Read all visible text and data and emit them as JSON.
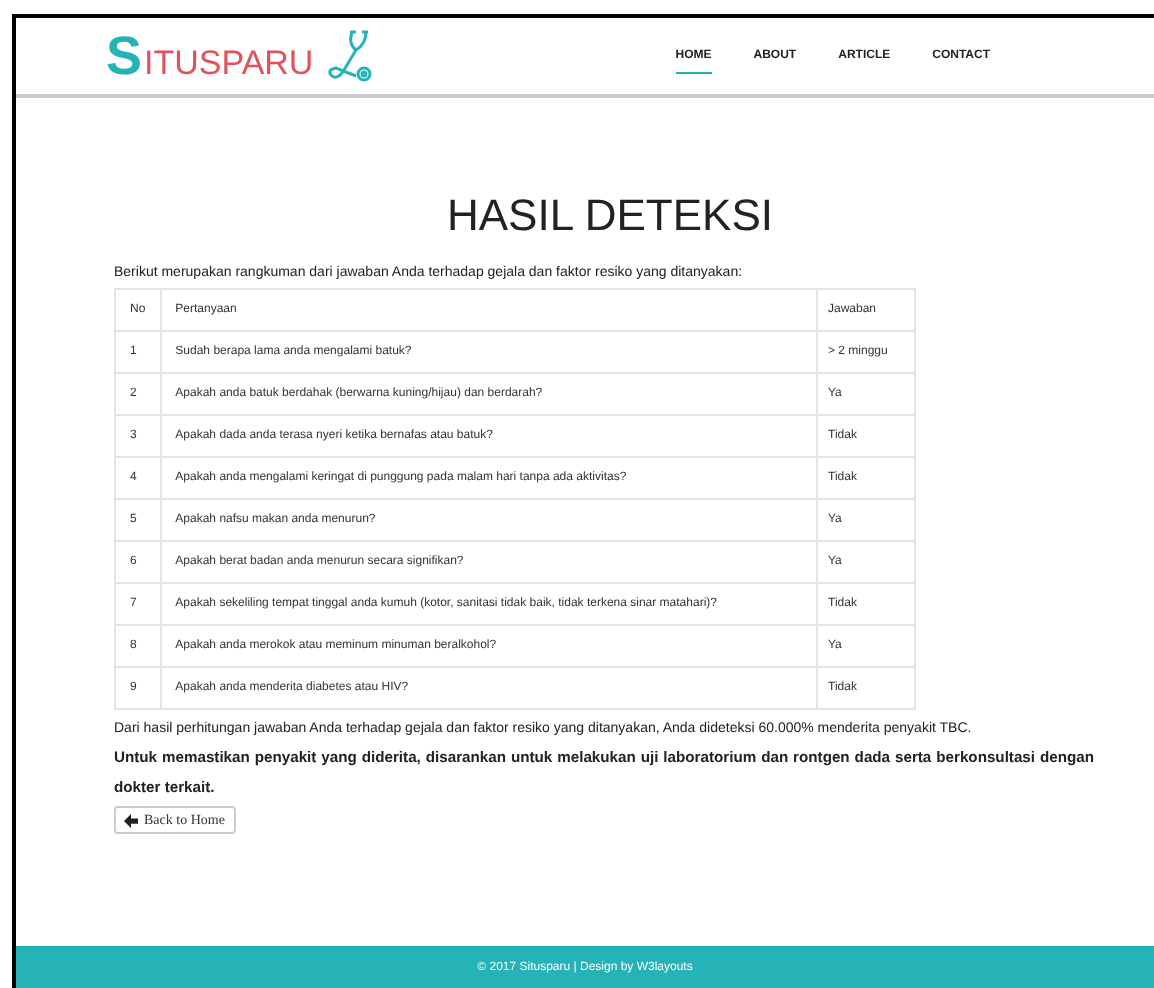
{
  "header": {
    "logo": {
      "initial": "S",
      "rest": "ITUSPARU"
    },
    "nav": [
      {
        "label": "HOME",
        "selected": true
      },
      {
        "label": "ABOUT",
        "selected": false
      },
      {
        "label": "ARTICLE",
        "selected": false
      },
      {
        "label": "CONTACT",
        "selected": false
      }
    ]
  },
  "title": "HASIL DETEKSI",
  "intro": "Berikut merupakan rangkuman dari jawaban Anda terhadap gejala dan faktor resiko yang ditanyakan:",
  "table": {
    "columns": [
      "No",
      "Pertanyaan",
      "Jawaban"
    ],
    "rows": [
      [
        "1",
        "Sudah berapa lama anda mengalami batuk?",
        "> 2 minggu"
      ],
      [
        "2",
        "Apakah anda batuk berdahak (berwarna kuning/hijau) dan berdarah?",
        "Ya"
      ],
      [
        "3",
        "Apakah dada anda terasa nyeri ketika bernafas atau batuk?",
        "Tidak"
      ],
      [
        "4",
        "Apakah anda mengalami keringat di punggung pada malam hari tanpa ada aktivitas?",
        "Tidak"
      ],
      [
        "5",
        "Apakah nafsu makan anda menurun?",
        "Ya"
      ],
      [
        "6",
        "Apakah berat badan anda menurun secara signifikan?",
        "Ya"
      ],
      [
        "7",
        "Apakah sekeliling tempat tinggal anda kumuh (kotor, sanitasi tidak baik, tidak terkena sinar matahari)?",
        "Tidak"
      ],
      [
        "8",
        "Apakah anda merokok atau meminum minuman beralkohol?",
        "Ya"
      ],
      [
        "9",
        "Apakah anda menderita diabetes atau HIV?",
        "Tidak"
      ]
    ]
  },
  "result": "Dari hasil perhitungan jawaban Anda terhadap gejala dan faktor resiko yang ditanyakan, Anda dideteksi 60.000% menderita penyakit TBC.",
  "advice": "Untuk memastikan penyakit yang diderita, disarankan untuk melakukan uji laboratorium dan rontgen dada serta berkonsultasi dengan dokter terkait.",
  "back_button": "Back to Home",
  "footer": "© 2017 Situsparu | Design by W3layouts"
}
